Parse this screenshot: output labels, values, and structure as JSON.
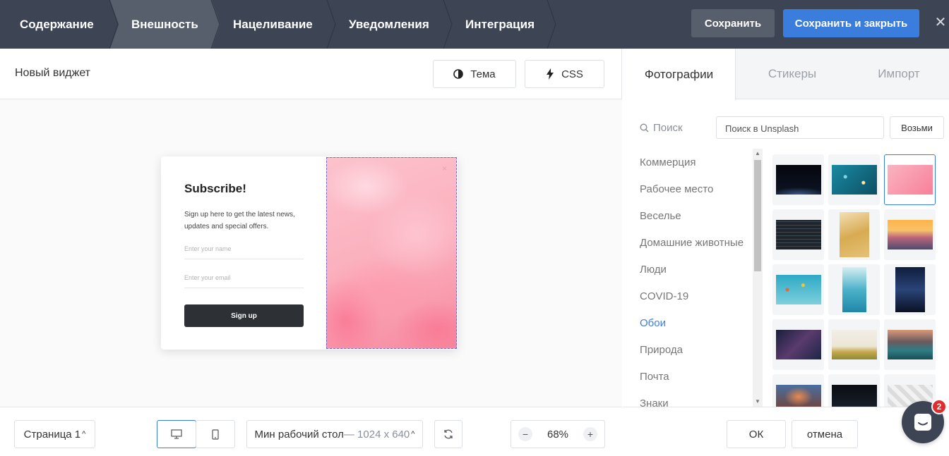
{
  "steps": [
    {
      "label": "Содержание"
    },
    {
      "label": "Внешность"
    },
    {
      "label": "Нацеливание"
    },
    {
      "label": "Уведомления"
    },
    {
      "label": "Интеграция"
    }
  ],
  "header": {
    "save_label": "Сохранить",
    "save_close_label": "Сохранить и закрыть",
    "close_symbol": "✕"
  },
  "editor": {
    "widget_name": "Новый виджет",
    "theme_label": "Тема",
    "css_label": "CSS"
  },
  "popup": {
    "title": "Subscribe!",
    "text": "Sign up here to get the latest news, updates and special offers.",
    "name_placeholder": "Enter your name",
    "email_placeholder": "Enter your email",
    "button_label": "Sign up",
    "close_symbol": "×"
  },
  "footer": {
    "page_label": "Страница 1",
    "device_label": "Мин рабочий стол",
    "device_size": "— 1024 x 640",
    "zoom_value": "68%",
    "zoom_minus": "−",
    "zoom_plus": "+"
  },
  "panel": {
    "tabs": [
      {
        "label": "Фотографии"
      },
      {
        "label": "Стикеры"
      },
      {
        "label": "Импорт"
      }
    ],
    "search_label": "Поиск",
    "search_placeholder": "Поиск в Unsplash",
    "search_button": "Возьми",
    "categories": [
      {
        "label": "Коммерция"
      },
      {
        "label": "Рабочее место"
      },
      {
        "label": "Веселье"
      },
      {
        "label": "Домашние животные"
      },
      {
        "label": "Люди"
      },
      {
        "label": "COVID-19"
      },
      {
        "label": "Обои"
      },
      {
        "label": "Природа"
      },
      {
        "label": "Почта"
      },
      {
        "label": "Знаки"
      }
    ],
    "active_category": "Обои",
    "ok_label": "ОК",
    "cancel_label": "отмена"
  },
  "chat": {
    "badge": "2"
  },
  "colors": {
    "topbar": "#3d4453",
    "accent": "#3b7ddd",
    "popup_button": "#2d3035"
  }
}
